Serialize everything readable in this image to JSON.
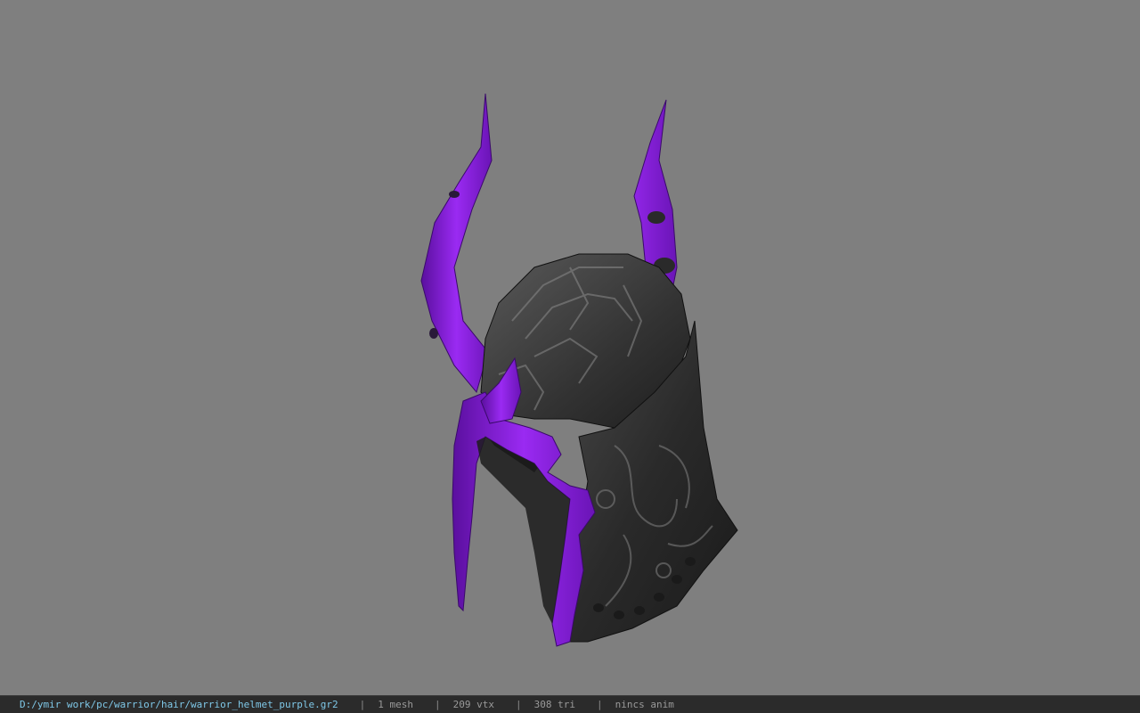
{
  "viewer": {
    "background_color": "#7f7f7f",
    "model_icon": "horned-helmet-model",
    "accent_color": "#8a1ee0"
  },
  "statusbar": {
    "file_path": "D:/ymir work/pc/warrior/hair/warrior_helmet_purple.gr2",
    "separator": "|",
    "mesh_count": "1 mesh",
    "vertex_count": "209 vtx",
    "triangle_count": "308 tri",
    "anim_status": "nincs anim"
  }
}
